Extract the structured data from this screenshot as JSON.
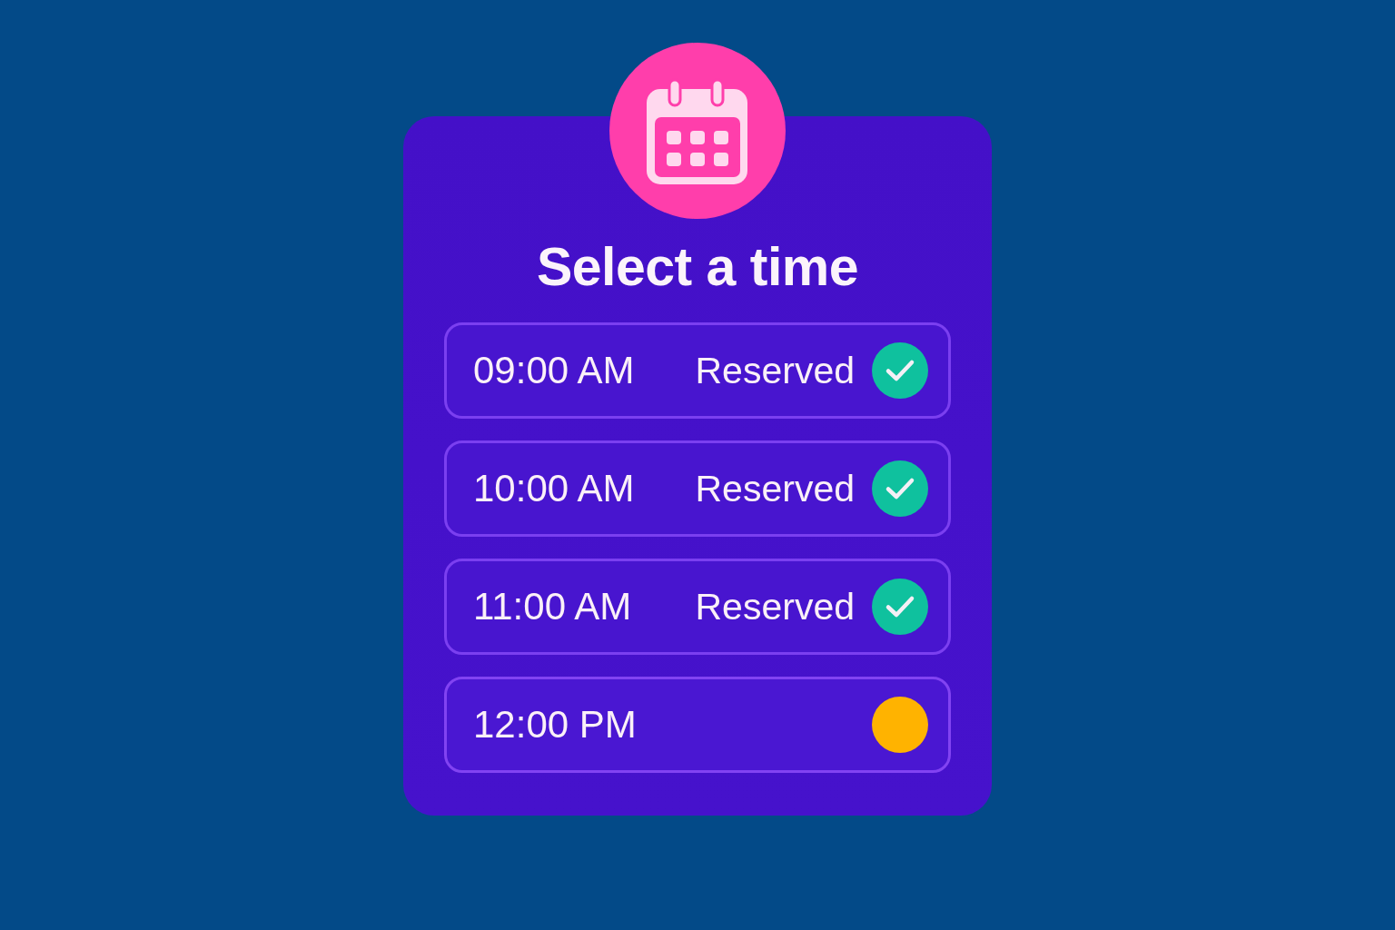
{
  "title": "Select a time",
  "slots": [
    {
      "time": "09:00 AM",
      "status": "Reserved",
      "reserved": true,
      "color": "#0fc19e"
    },
    {
      "time": "10:00 AM",
      "status": "Reserved",
      "reserved": true,
      "color": "#0fc19e"
    },
    {
      "time": "11:00 AM",
      "status": "Reserved",
      "reserved": true,
      "color": "#0fc19e"
    },
    {
      "time": "12:00 PM",
      "reserved": false,
      "color": "#ffb300"
    }
  ]
}
